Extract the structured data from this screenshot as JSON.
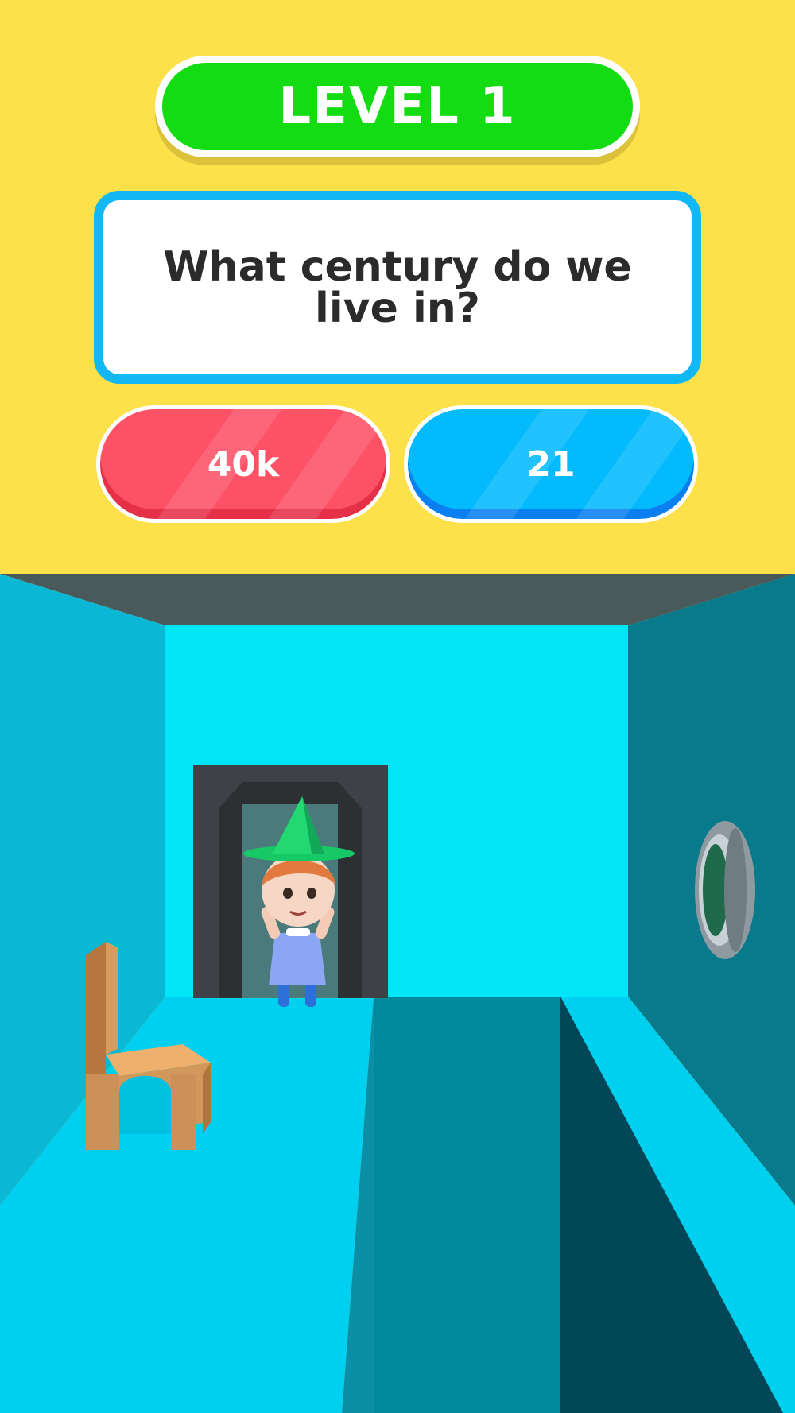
{
  "level": {
    "label": "LEVEL 1"
  },
  "question": {
    "text": "What century do we live in?"
  },
  "answers": [
    {
      "label": "40k",
      "color": "#fd5166"
    },
    {
      "label": "21",
      "color": "#03bafd"
    }
  ],
  "colors": {
    "background": "#fde14a",
    "level_pill": "#13dd12",
    "question_border": "#12b8f3",
    "room_back_wall": "#00e5f8",
    "room_floor": "#00d0ef"
  },
  "scene": {
    "character": "boy-with-green-hat",
    "objects": [
      "wooden-chair",
      "doorway",
      "round-porthole"
    ]
  }
}
